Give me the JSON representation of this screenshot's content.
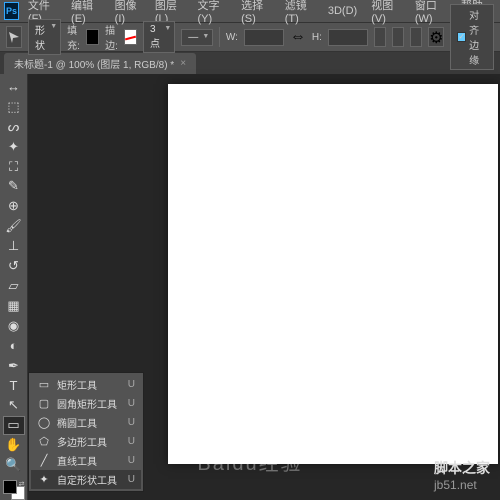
{
  "app": {
    "logo": "Ps"
  },
  "menu": [
    "文件(F)",
    "编辑(E)",
    "图像(I)",
    "图层(L)",
    "文字(Y)",
    "选择(S)",
    "滤镜(T)",
    "3D(D)",
    "视图(V)",
    "窗口(W)",
    "帮助(H)"
  ],
  "options": {
    "mode": "形状",
    "fill_label": "填充:",
    "stroke_label": "描边:",
    "stroke_width": "3 点",
    "w_label": "W:",
    "w_value": "",
    "h_label": "H:",
    "h_value": "",
    "align_label": "对齐边缘",
    "align_checked": true
  },
  "tab": {
    "title": "未标题-1 @ 100% (图层 1, RGB/8) *"
  },
  "tools": [
    "move",
    "marquee",
    "lasso",
    "wand",
    "crop",
    "eyedropper",
    "heal",
    "brush",
    "stamp",
    "history",
    "eraser",
    "gradient",
    "blur",
    "dodge",
    "pen",
    "type",
    "path",
    "shape",
    "hand",
    "zoom"
  ],
  "flyout": {
    "items": [
      {
        "icon": "▭",
        "label": "矩形工具",
        "key": "U"
      },
      {
        "icon": "▢",
        "label": "圆角矩形工具",
        "key": "U"
      },
      {
        "icon": "◯",
        "label": "椭圆工具",
        "key": "U"
      },
      {
        "icon": "⬠",
        "label": "多边形工具",
        "key": "U"
      },
      {
        "icon": "╱",
        "label": "直线工具",
        "key": "U"
      },
      {
        "icon": "✦",
        "label": "自定形状工具",
        "key": "U",
        "selected": true
      }
    ]
  },
  "watermarks": {
    "baidu": "Baidu经验",
    "site_sub": "脚本之家",
    "site": "jb51.net"
  }
}
